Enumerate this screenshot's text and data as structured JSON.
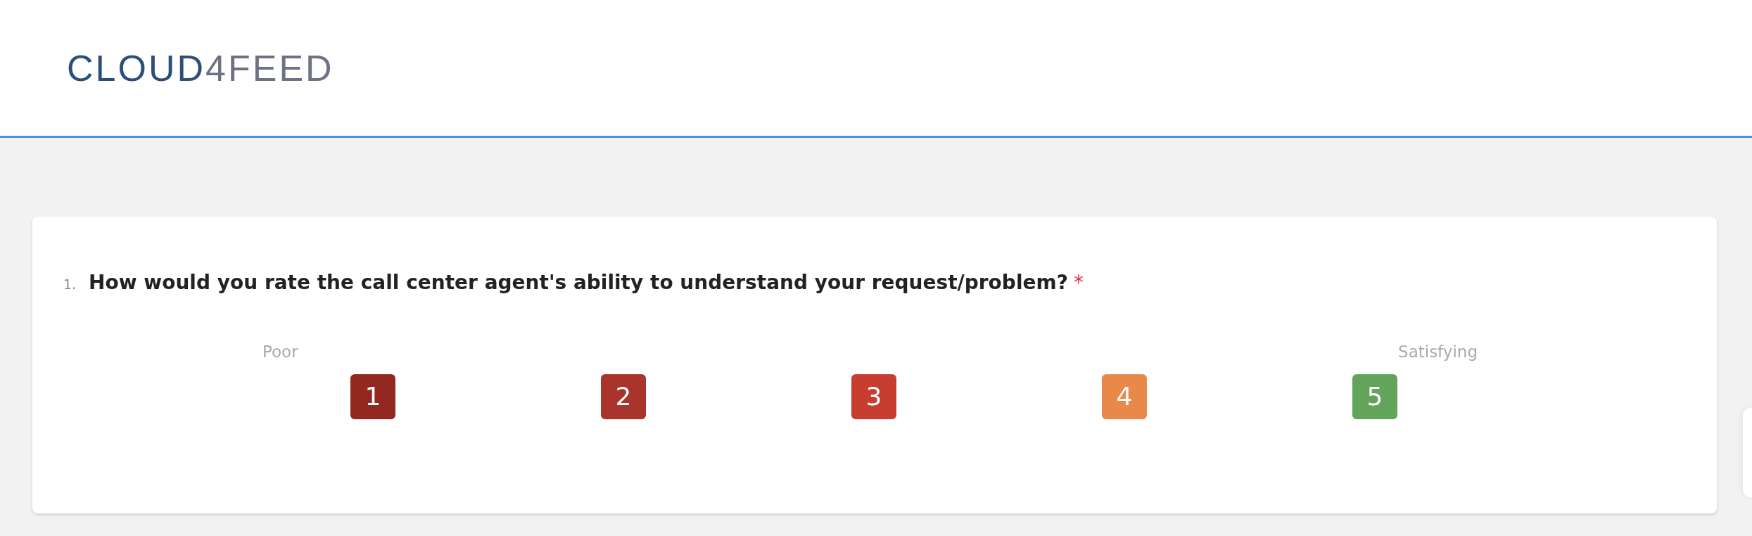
{
  "logo": {
    "primary": "CLOUD",
    "secondary": "4FEED"
  },
  "question": {
    "number": "1.",
    "text": "How would you rate the call center agent's ability to understand your request/problem?",
    "required": true,
    "required_mark": "*",
    "scale_low": "Poor",
    "scale_high": "Satisfying",
    "options": [
      {
        "label": "1",
        "color": "#922820",
        "selected": false
      },
      {
        "label": "2",
        "color": "#a9342b",
        "selected": false
      },
      {
        "label": "3",
        "color": "#c73e31",
        "selected": false
      },
      {
        "label": "4",
        "color": "#e8894a",
        "selected": false
      },
      {
        "label": "5",
        "color": "#62a55a",
        "selected": false
      }
    ]
  }
}
